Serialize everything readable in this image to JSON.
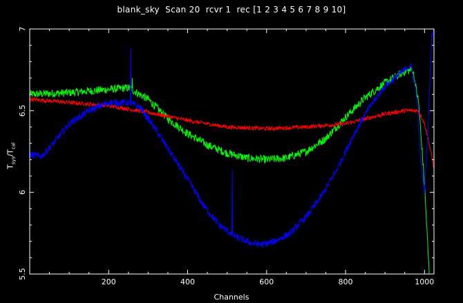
{
  "chart_data": {
    "type": "line",
    "title": "blank_sky  Scan 20  rcvr 1  rec [1 2 3 4 5 6 7 8 9 10]",
    "xlabel": "Channels",
    "ylabel": "Tsys/Tcal",
    "ylabel_parts": {
      "main1": "T",
      "sub1": "sys",
      "sep": "/",
      "main2": "T",
      "sub2": "cal"
    },
    "xlim": [
      0,
      1024
    ],
    "ylim": [
      5.5,
      7.0
    ],
    "x_ticks": [
      200,
      400,
      600,
      800,
      1000
    ],
    "y_ticks": [
      5.5,
      6,
      6.5,
      7
    ],
    "y_tick_labels": [
      "5.5",
      "6",
      "6.5",
      "7"
    ],
    "grid": false,
    "series": [
      {
        "color": "#00ff00",
        "noise": 0.025,
        "x": [
          0,
          100,
          200,
          250,
          300,
          350,
          400,
          450,
          500,
          550,
          600,
          650,
          700,
          750,
          800,
          850,
          900,
          950,
          970,
          985,
          1000,
          1012
        ],
        "values": [
          6.6,
          6.61,
          6.63,
          6.64,
          6.57,
          6.45,
          6.36,
          6.29,
          6.24,
          6.21,
          6.2,
          6.21,
          6.25,
          6.33,
          6.46,
          6.58,
          6.67,
          6.74,
          6.75,
          6.55,
          6.05,
          5.5
        ],
        "spikes": [
          [
            260,
            6.7
          ]
        ]
      },
      {
        "color": "#ff0000",
        "noise": 0.013,
        "x": [
          0,
          100,
          200,
          250,
          300,
          400,
          500,
          600,
          700,
          800,
          850,
          900,
          950,
          985,
          1000,
          1010,
          1024
        ],
        "values": [
          6.57,
          6.55,
          6.53,
          6.51,
          6.49,
          6.44,
          6.4,
          6.39,
          6.4,
          6.42,
          6.45,
          6.48,
          6.5,
          6.5,
          6.42,
          6.32,
          6.15
        ],
        "spikes": []
      },
      {
        "color": "#0000ff",
        "noise": 0.022,
        "x": [
          0,
          30,
          60,
          100,
          150,
          200,
          250,
          280,
          320,
          360,
          400,
          440,
          480,
          520,
          560,
          590,
          620,
          660,
          700,
          740,
          780,
          820,
          860,
          900,
          940,
          965,
          980,
          990,
          1000,
          1010,
          1018,
          1024
        ],
        "values": [
          6.23,
          6.22,
          6.3,
          6.42,
          6.5,
          6.55,
          6.55,
          6.52,
          6.38,
          6.23,
          6.08,
          5.92,
          5.8,
          5.73,
          5.69,
          5.68,
          5.7,
          5.75,
          5.85,
          5.98,
          6.15,
          6.35,
          6.52,
          6.65,
          6.73,
          6.78,
          6.6,
          6.2,
          6.0,
          6.45,
          6.95,
          7.0
        ],
        "spikes": [
          [
            256,
            6.88
          ],
          [
            513,
            6.14
          ]
        ]
      }
    ]
  }
}
